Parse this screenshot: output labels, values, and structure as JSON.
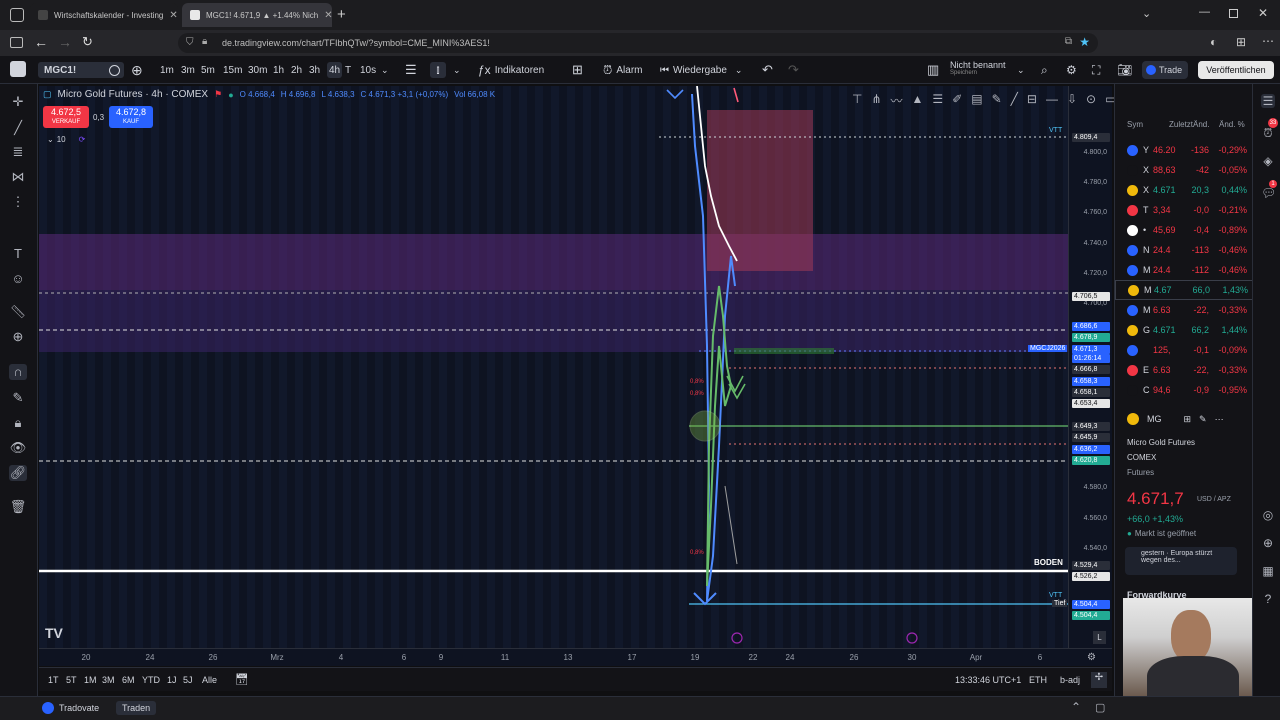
{
  "browser": {
    "tabs": [
      {
        "title": "Wirtschaftskalender - Investing",
        "active": false
      },
      {
        "title": "MGC1! 4.671,9 ▲ +1.44% Nich",
        "active": true
      }
    ],
    "url": "de.tradingview.com/chart/TFIbhQTw/?symbol=CME_MINI%3AES1!"
  },
  "toolbar": {
    "symbol": "MGC1!",
    "intervals": [
      "1m",
      "3m",
      "5m",
      "15m",
      "30m",
      "1h",
      "2h",
      "3h",
      "4h",
      "T",
      "10s"
    ],
    "active_interval": "4h",
    "indicators_label": "Indikatoren",
    "alarm_label": "Alarm",
    "replay_label": "Wiedergabe",
    "layout_name": "Nicht benannt",
    "layout_sub": "Speichern",
    "trade_label": "Trade",
    "publish_label": "Veröffentlichen"
  },
  "legend": {
    "title": "Micro Gold Futures · 4h · COMEX",
    "o": "O 4.668,4",
    "h": "H 4.696,8",
    "l": "L 4.638,3",
    "c": "C 4.671,3 +3,1 (+0,07%)",
    "vol": "Vol 66,08 K",
    "sell_price": "4.672,5",
    "sell_label": "VERKAUF",
    "spread": "0,3",
    "buy_price": "4.672,8",
    "buy_label": "KAUF",
    "indicator_count": "10"
  },
  "chart_labels": {
    "boden": "BODEN",
    "tief": "Tief",
    "mgc_tag": "MGCJ2026",
    "vtt_top": "VTT",
    "vtt_bottom": "VTT",
    "pct_labels": [
      "0,8%",
      "0,8%",
      "0,8%"
    ],
    "log_btn": "L",
    "auto_btn": "A"
  },
  "price_scale": {
    "labels": [
      "4.800,0",
      "4.780,0",
      "4.760,0",
      "4.740,0",
      "4.720,0",
      "4.700,0",
      "4.580,0",
      "4.560,0",
      "4.540,0"
    ],
    "tags": [
      {
        "v": "4.809,4",
        "c": "#2a2e39"
      },
      {
        "v": "4.706,5",
        "c": "#e6e6e6"
      },
      {
        "v": "4.686,6",
        "c": "#2962ff"
      },
      {
        "v": "4.678,9",
        "c": "#22ab94"
      },
      {
        "v": "4.671,3",
        "c": "#2962ff"
      },
      {
        "v": "01:26:14",
        "c": "#2962ff"
      },
      {
        "v": "4.666,8",
        "c": "#2a2e39"
      },
      {
        "v": "4.658,3",
        "c": "#2962ff"
      },
      {
        "v": "4.658,1",
        "c": "#2a2e39"
      },
      {
        "v": "4.653,4",
        "c": "#e6e6e6"
      },
      {
        "v": "4.649,3",
        "c": "#2a2e39"
      },
      {
        "v": "4.645,9",
        "c": "#2a2e39"
      },
      {
        "v": "4.636,2",
        "c": "#2962ff"
      },
      {
        "v": "4.620,8",
        "c": "#22ab94"
      },
      {
        "v": "4.529,4",
        "c": "#2a2e39"
      },
      {
        "v": "4.526,2",
        "c": "#e6e6e6"
      },
      {
        "v": "4.504,4",
        "c": "#2962ff"
      },
      {
        "v": "4.504,4",
        "c": "#22ab94"
      }
    ]
  },
  "time_axis": [
    "20",
    "24",
    "26",
    "Mrz",
    "4",
    "6",
    "9",
    "11",
    "13",
    "17",
    "19",
    "22",
    "24",
    "26",
    "30",
    "Apr",
    "6"
  ],
  "ranges": [
    "1T",
    "5T",
    "1M",
    "3M",
    "6M",
    "YTD",
    "1J",
    "5J",
    "Alle"
  ],
  "status": {
    "time": "13:33:46 UTC+1",
    "session": "ETH",
    "adj": "b-adj"
  },
  "bottom": {
    "tradovate": "Tradovate",
    "traden": "Traden"
  },
  "watchlist": {
    "headers": [
      "Sym",
      "Zuletzt",
      "Änd.",
      "Änd. %"
    ],
    "rows": [
      {
        "sym": "Y",
        "last": "46.20",
        "chg": "-136",
        "chgp": "-0,29%",
        "color": "#2962ff",
        "pos": false
      },
      {
        "sym": "X",
        "last": "88,63",
        "chg": "-42",
        "chgp": "-0,05%",
        "color": "#131317",
        "pos": false
      },
      {
        "sym": "X",
        "last": "4.671",
        "chg": "20,3",
        "chgp": "0,44%",
        "color": "#f0b90b",
        "pos": true
      },
      {
        "sym": "T",
        "last": "3,34",
        "chg": "-0,0",
        "chgp": "-0,21%",
        "color": "#f23645",
        "pos": false
      },
      {
        "sym": "•",
        "last": "45,69",
        "chg": "-0,4",
        "chgp": "-0,89%",
        "color": "#ffffff",
        "pos": false
      },
      {
        "sym": "N",
        "last": "24.4",
        "chg": "-113",
        "chgp": "-0,46%",
        "color": "#2962ff",
        "pos": false
      },
      {
        "sym": "M",
        "last": "24.4",
        "chg": "-112",
        "chgp": "-0,46%",
        "color": "#2962ff",
        "pos": false
      },
      {
        "sym": "M",
        "last": "4.67",
        "chg": "66,0",
        "chgp": "1,43%",
        "color": "#f0b90b",
        "pos": true
      },
      {
        "sym": "M",
        "last": "6.63",
        "chg": "-22,",
        "chgp": "-0,33%",
        "color": "#2962ff",
        "pos": false
      },
      {
        "sym": "G",
        "last": "4.671",
        "chg": "66,2",
        "chgp": "1,44%",
        "color": "#f0b90b",
        "pos": true
      },
      {
        "sym": "",
        "last": "125,",
        "chg": "-0,1",
        "chgp": "-0,09%",
        "color": "#2962ff",
        "pos": false
      },
      {
        "sym": "E",
        "last": "6.63",
        "chg": "-22,",
        "chgp": "-0,33%",
        "color": "#f23645",
        "pos": false
      },
      {
        "sym": "C",
        "last": "94,6",
        "chg": "-0,9",
        "chgp": "-0,95%",
        "color": "#131317",
        "pos": false
      }
    ]
  },
  "details": {
    "symbol_short": "MG",
    "name": "Micro Gold Futures",
    "exchange": "COMEX",
    "type": "Futures",
    "price": "4.671,7",
    "currency": "USD / APZ",
    "change": "+66,0 +1,43%",
    "market_status": "Markt ist geöffnet",
    "news": "gestern · Europa stürzt wegen des...",
    "section": "Forwardkurve"
  }
}
